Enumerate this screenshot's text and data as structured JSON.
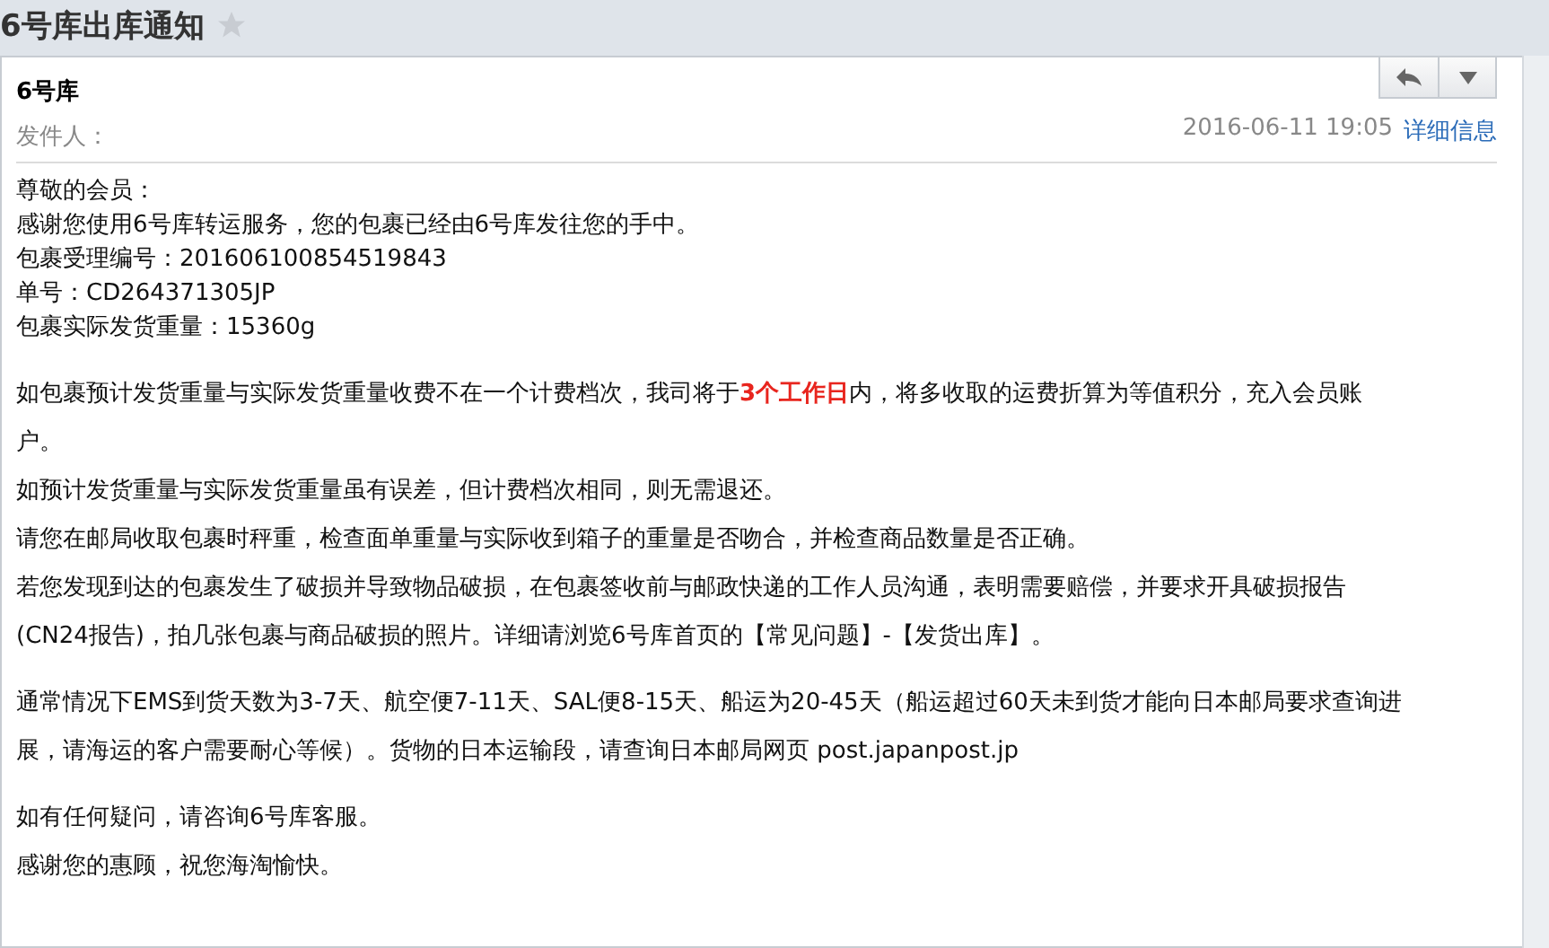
{
  "subject": {
    "title": "6号库出库通知",
    "starred": false
  },
  "header": {
    "sender_name": "6号库",
    "sender_line": "发件人：",
    "date": "2016-06-11 19:05",
    "details_link": "详细信息"
  },
  "body": [
    {
      "kind": "compact",
      "paragraphs": [
        {
          "parts": [
            {
              "text": "尊敬的会员：",
              "highlight": false
            }
          ]
        },
        {
          "parts": [
            {
              "text": "感谢您使用6号库转运服务，您的包裹已经由6号库发往您的手中。",
              "highlight": false
            }
          ]
        },
        {
          "parts": [
            {
              "text": "包裹受理编号：201606100854519843",
              "highlight": false
            }
          ]
        },
        {
          "parts": [
            {
              "text": "单号：CD264371305JP",
              "highlight": false
            }
          ]
        },
        {
          "parts": [
            {
              "text": "包裹实际发货重量：15360g",
              "highlight": false
            }
          ]
        }
      ]
    },
    {
      "kind": "loose",
      "paragraphs": [
        {
          "parts": [
            {
              "text": "如包裹预计发货重量与实际发货重量收费不在一个计费档次，我司将于",
              "highlight": false
            },
            {
              "text": "3个工作日",
              "highlight": true
            },
            {
              "text": "内，将多收取的运费折算为等值积分，充入会员账户。",
              "highlight": false
            }
          ]
        },
        {
          "parts": [
            {
              "text": "如预计发货重量与实际发货重量虽有误差，但计费档次相同，则无需退还。",
              "highlight": false
            }
          ]
        },
        {
          "parts": [
            {
              "text": "请您在邮局收取包裹时秤重，检查面单重量与实际收到箱子的重量是否吻合，并检查商品数量是否正确。",
              "highlight": false
            }
          ]
        },
        {
          "parts": [
            {
              "text": "若您发现到达的包裹发生了破损并导致物品破损，在包裹签收前与邮政快递的工作人员沟通，表明需要赔偿，并要求开具破损报告(CN24报告)，拍几张包裹与商品破损的照片。详细请浏览6号库首页的【常见问题】-【发货出库】。",
              "highlight": false
            }
          ]
        }
      ]
    },
    {
      "kind": "loose",
      "paragraphs": [
        {
          "parts": [
            {
              "text": "通常情况下EMS到货天数为3-7天、航空便7-11天、SAL便8-15天、船运为20-45天（船运超过60天未到货才能向日本邮局要求查询进展，请海运的客户需要耐心等候）。货物的日本运输段，请查询日本邮局网页 post.japanpost.jp",
              "highlight": false
            }
          ]
        }
      ]
    },
    {
      "kind": "loose",
      "paragraphs": [
        {
          "parts": [
            {
              "text": "如有任何疑问，请咨询6号库客服。",
              "highlight": false
            }
          ]
        },
        {
          "parts": [
            {
              "text": "感谢您的惠顾，祝您海淘愉快。",
              "highlight": false
            }
          ]
        }
      ]
    }
  ]
}
